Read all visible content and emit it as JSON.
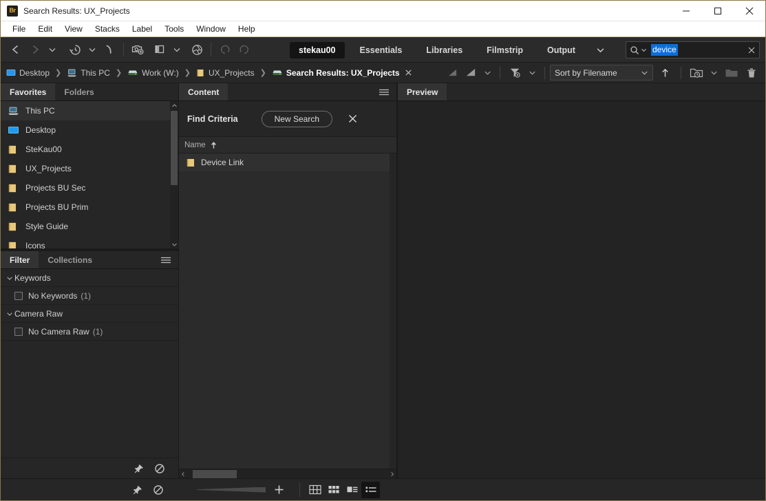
{
  "window": {
    "title": "Search Results: UX_Projects",
    "app_badge": "Br",
    "controls": [
      {
        "name": "minimize-button",
        "glyph": "minimize"
      },
      {
        "name": "maximize-button",
        "glyph": "maximize"
      },
      {
        "name": "close-button",
        "glyph": "close"
      }
    ]
  },
  "menubar": {
    "items": [
      "File",
      "Edit",
      "View",
      "Stacks",
      "Label",
      "Tools",
      "Window",
      "Help"
    ]
  },
  "toolbar": {
    "nav": [
      {
        "name": "back-icon",
        "label": "Back"
      },
      {
        "name": "forward-icon",
        "label": "Forward"
      },
      {
        "name": "chevron-down-icon",
        "label": "Navigation history"
      },
      {
        "name": "recent-history-icon",
        "label": "Recent folders"
      },
      {
        "name": "chevron-down-icon",
        "label": "Recent folders menu"
      },
      {
        "name": "boomerang-icon",
        "label": "Reveal in Bridge"
      }
    ],
    "actions": [
      {
        "name": "get-photos-from-camera-icon",
        "label": "Get photos from camera"
      },
      {
        "name": "refine-stack-icon",
        "label": "Refine"
      },
      {
        "name": "chevron-down-icon",
        "label": "Refine menu"
      },
      {
        "name": "camera-raw-icon",
        "label": "Open in Camera Raw"
      }
    ],
    "undo": [
      {
        "name": "rotate-counterclockwise-icon",
        "label": "Rotate 90° counterclockwise"
      },
      {
        "name": "rotate-clockwise-icon",
        "label": "Rotate 90° clockwise"
      }
    ],
    "workspaces": [
      "stekau00",
      "Essentials",
      "Libraries",
      "Filmstrip",
      "Output"
    ],
    "active_workspace": "stekau00",
    "workspace_overflow_icon": "chevron-down-icon"
  },
  "search": {
    "value": "device",
    "placeholder": "Search",
    "icon": "search-icon",
    "dropdown_icon": "chevron-down-icon",
    "clear_icon": "close-icon",
    "selected": true,
    "selection_color": "#0b6fd8"
  },
  "pathbar": {
    "crumbs": [
      {
        "label": "Desktop",
        "icon": "desktop-icon",
        "current": false
      },
      {
        "label": "This PC",
        "icon": "computer-icon",
        "current": false
      },
      {
        "label": "Work (W:)",
        "icon": "network-drive-icon",
        "current": false
      },
      {
        "label": "UX_Projects",
        "icon": "folder-icon",
        "current": false
      },
      {
        "label": "Search Results: UX_Projects",
        "icon": "search-results-icon",
        "current": true
      }
    ],
    "close_label": "Close search results",
    "tools": [
      {
        "name": "filter-rating-icon",
        "label": "Filter items by rating"
      },
      {
        "name": "sort-rating-icon",
        "label": "Sort by rating"
      },
      {
        "name": "chevron-down-icon",
        "label": "Rating menu"
      },
      {
        "name": "filter-funnel-icon",
        "label": "Filter items"
      },
      {
        "name": "chevron-down-icon",
        "label": "Filter menu"
      }
    ],
    "sort": {
      "value": "Sort by Filename",
      "chevron": "chevron-down-icon"
    },
    "sort_direction_icon": "arrow-up-icon",
    "right_tools": [
      {
        "name": "new-folder-recent-icon",
        "label": "Open recent"
      },
      {
        "name": "chevron-down-icon",
        "label": "Open recent menu"
      },
      {
        "name": "new-folder-icon",
        "label": "Create a new folder"
      },
      {
        "name": "trash-icon",
        "label": "Delete item"
      }
    ]
  },
  "favorites_panel": {
    "tabs": [
      {
        "label": "Favorites",
        "active": true
      },
      {
        "label": "Folders",
        "active": false
      }
    ],
    "items": [
      {
        "label": "This PC",
        "icon": "computer-icon",
        "selected": true
      },
      {
        "label": "Desktop",
        "icon": "desktop-icon",
        "selected": false
      },
      {
        "label": "SteKau00",
        "icon": "folder-icon",
        "selected": false
      },
      {
        "label": "UX_Projects",
        "icon": "folder-icon",
        "selected": false
      },
      {
        "label": "Projects BU Sec",
        "icon": "folder-icon",
        "selected": false
      },
      {
        "label": "Projects BU Prim",
        "icon": "folder-icon",
        "selected": false
      },
      {
        "label": "Style Guide",
        "icon": "folder-icon",
        "selected": false
      },
      {
        "label": "Icons",
        "icon": "folder-icon",
        "selected": false
      }
    ],
    "scroll_up_icon": "chevron-up-icon",
    "scroll_down_icon": "chevron-down-icon"
  },
  "filter_panel": {
    "tabs": [
      {
        "label": "Filter",
        "active": true
      },
      {
        "label": "Collections",
        "active": false
      }
    ],
    "menu_icon": "panel-menu-icon",
    "groups": [
      {
        "label": "Keywords",
        "expanded": true,
        "toggle_icon": "chevron-down-icon",
        "rows": [
          {
            "label": "No Keywords",
            "count": "(1)",
            "checked": false
          }
        ]
      },
      {
        "label": "Camera Raw",
        "expanded": true,
        "toggle_icon": "chevron-down-icon",
        "rows": [
          {
            "label": "No Camera Raw",
            "count": "(1)",
            "checked": false
          }
        ]
      }
    ],
    "footer": [
      {
        "name": "keep-filter-pin-icon",
        "label": "Keep filter when navigating"
      },
      {
        "name": "clear-filter-icon",
        "label": "Clear filter"
      }
    ]
  },
  "content_panel": {
    "tabs": [
      {
        "label": "Content",
        "active": true
      }
    ],
    "menu_icon": "panel-menu-icon",
    "find_criteria_label": "Find Criteria",
    "new_search_label": "New Search",
    "close_icon": "close-icon",
    "column_header": {
      "label": "Name",
      "sort_icon": "arrow-up-icon"
    },
    "items": [
      {
        "label": "Device Link",
        "icon": "folder-icon",
        "selected": true
      }
    ],
    "hscroll": {
      "left_icon": "chevron-left-icon",
      "right_icon": "chevron-right-icon"
    }
  },
  "preview_panel": {
    "tabs": [
      {
        "label": "Preview",
        "active": true
      }
    ]
  },
  "statusbar": {
    "thumbnail_slider_label": "Thumbnail size",
    "plus_icon": "plus-icon",
    "view_modes": [
      {
        "name": "view-mode-grid-icon",
        "label": "View content as grid",
        "active": false
      },
      {
        "name": "view-mode-thumbnails-icon",
        "label": "View content as thumbnails",
        "active": false
      },
      {
        "name": "view-mode-details-icon",
        "label": "View content as details",
        "active": false
      },
      {
        "name": "view-mode-list-icon",
        "label": "View content as list",
        "active": true
      }
    ]
  },
  "colors": {
    "accent": "#0b6fd8",
    "window_border": "#8a7549",
    "panel_bg": "#262626",
    "app_bg": "#1e1e1e",
    "folder_icon": "#e8c87a"
  }
}
